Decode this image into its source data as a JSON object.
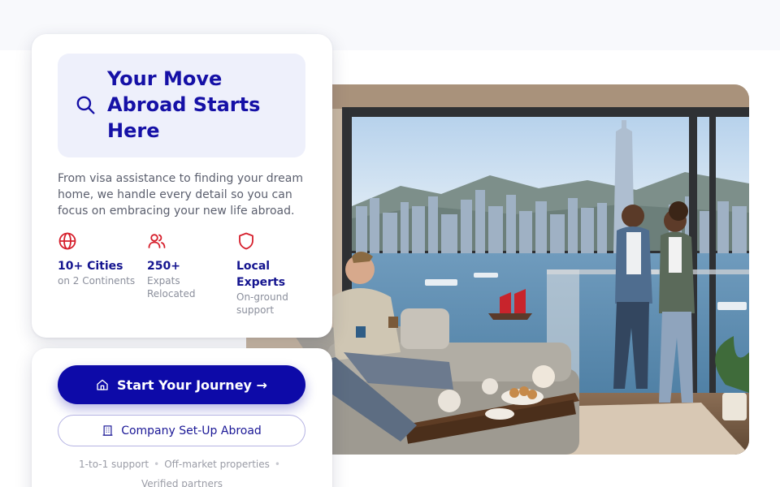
{
  "hero": {
    "headline": "Your Move Abroad Starts Here",
    "description": "From visa assistance to finding your dream home, we handle every detail so you can focus on embracing your new life abroad."
  },
  "stats": [
    {
      "icon": "globe-icon",
      "value": "10+ Cities",
      "sub": "on 2 Continents"
    },
    {
      "icon": "users-icon",
      "value": "250+",
      "sub": "Expats Relocated"
    },
    {
      "icon": "shield-icon",
      "value": "Local Experts",
      "sub": "On-ground support"
    }
  ],
  "cta": {
    "primary_label": "Start Your Journey →",
    "primary_icon": "home-icon",
    "secondary_label": "Company Set-Up Abroad",
    "secondary_icon": "building-icon"
  },
  "trust_items": [
    "1-to-1 support",
    "Off-market properties",
    "Verified partners"
  ],
  "colors": {
    "brand": "#0d0aa8",
    "accent_red": "#d61f2c",
    "headline_bg": "#eef0fb"
  }
}
